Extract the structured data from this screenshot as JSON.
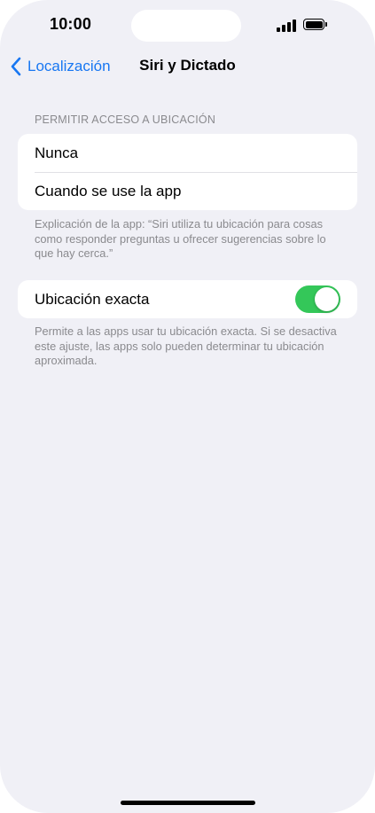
{
  "status_bar": {
    "time": "10:00",
    "signal_icon": "signal-bars-icon",
    "battery_icon": "battery-full-icon"
  },
  "nav": {
    "back_label": "Localización",
    "back_icon": "chevron-left-icon",
    "title": "Siri y Dictado"
  },
  "location_access": {
    "header": "PERMITIR ACCESO A UBICACIÓN",
    "options": [
      "Nunca",
      "Cuando se use la app"
    ],
    "footer": "Explicación de la app: “Siri utiliza tu ubicación para cosas como responder preguntas u ofrecer sugerencias sobre lo que hay cerca.”"
  },
  "precise_location": {
    "label": "Ubicación exacta",
    "enabled": true,
    "footer": "Permite a las apps usar tu ubicación exacta. Si se desactiva este ajuste, las apps solo pueden determinar tu ubicación aproximada."
  },
  "colors": {
    "accent": "#1877f2",
    "toggle_on": "#34c759",
    "background": "#f0f0f6"
  }
}
